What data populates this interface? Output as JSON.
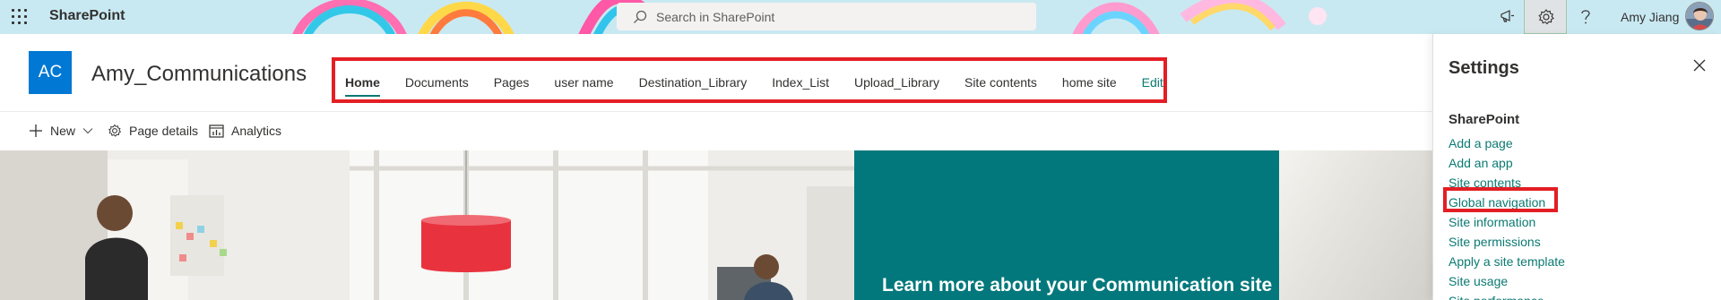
{
  "suite_bar": {
    "app_name": "SharePoint",
    "search_placeholder": "Search in SharePoint",
    "user_name": "Amy Jiang",
    "icons": [
      "waffle-icon",
      "search-icon",
      "megaphone-icon",
      "gear-icon",
      "help-icon"
    ]
  },
  "site_header": {
    "logo_initials": "AC",
    "title": "Amy_Communications",
    "nav": [
      {
        "label": "Home",
        "active": true
      },
      {
        "label": "Documents"
      },
      {
        "label": "Pages"
      },
      {
        "label": "user name"
      },
      {
        "label": "Destination_Library"
      },
      {
        "label": "Index_List"
      },
      {
        "label": "Upload_Library"
      },
      {
        "label": "Site contents"
      },
      {
        "label": "home site"
      },
      {
        "label": "Edit"
      }
    ]
  },
  "command_bar": {
    "new_label": "New",
    "page_details_label": "Page details",
    "analytics_label": "Analytics"
  },
  "hero": {
    "teal_text": "Learn more about your Communication site"
  },
  "settings_panel": {
    "title": "Settings",
    "section": "SharePoint",
    "links": [
      "Add a page",
      "Add an app",
      "Site contents",
      "Global navigation",
      "Site information",
      "Site permissions",
      "Apply a site template",
      "Site usage",
      "Site performance"
    ],
    "highlighted": "Global navigation"
  },
  "colors": {
    "suite_bar_bg": "#c9e9f2",
    "brand_blue": "#0078d4",
    "theme_teal": "#0b7a72",
    "hero_teal": "#03787c",
    "annotation_red": "#e31e24"
  }
}
